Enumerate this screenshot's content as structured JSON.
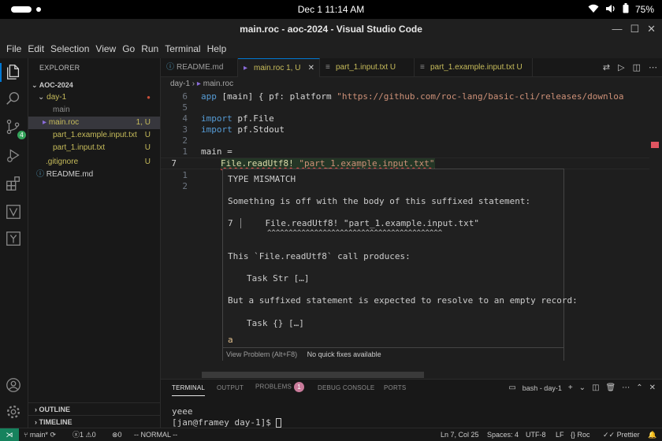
{
  "android": {
    "time": "Dec 1  11:14 AM",
    "battery": "75%"
  },
  "window": {
    "title": "main.roc - aoc-2024 - Visual Studio Code"
  },
  "menu": [
    "File",
    "Edit",
    "Selection",
    "View",
    "Go",
    "Run",
    "Terminal",
    "Help"
  ],
  "explorer": {
    "title": "EXPLORER",
    "root": "AOC-2024",
    "items": [
      {
        "label": "day-1",
        "status": "●"
      },
      {
        "label": "main",
        "status": ""
      },
      {
        "label": "main.roc",
        "status": "1, U"
      },
      {
        "label": "part_1.example.input.txt",
        "status": "U"
      },
      {
        "label": "part_1.input.txt",
        "status": "U"
      },
      {
        "label": ".gitignore",
        "status": "U"
      },
      {
        "label": "README.md",
        "status": ""
      }
    ],
    "outline": "OUTLINE",
    "timeline": "TIMELINE"
  },
  "tabs": [
    {
      "label": "README.md"
    },
    {
      "label": "main.roc  1, U"
    },
    {
      "label": "part_1.input.txt  U"
    },
    {
      "label": "part_1.example.input.txt  U"
    }
  ],
  "breadcrumb": {
    "folder": "day-1",
    "sep": "›",
    "file": "main.roc"
  },
  "editor": {
    "line_numbers": [
      "6",
      "5",
      "4",
      "3",
      "2",
      "1",
      "7",
      "1",
      "2"
    ],
    "lines": {
      "l1_kw": "app",
      "l1_rest": " [main] { pf: platform ",
      "l1_str": "\"https://github.com/roc-lang/basic-cli/releases/downloa",
      "l3_kw": "import",
      "l3_rest": " pf.File",
      "l4_kw": "import",
      "l4_rest": " pf.Stdout",
      "l6": "main =",
      "l7_fn": "File.readUtf8!",
      "l7_str": " \"part_1.example.input.txt\""
    }
  },
  "hover": {
    "title": "TYPE MISMATCH",
    "l1": "Something is off with the body of this suffixed statement:",
    "l2_num": "7",
    "l2_code": "    File.readUtf8! \"part_1.example.input.txt\"",
    "l3": "^^^^^^^^^^^^^^^^^^^^^^^^^^^^^^^^^^^^^^^^^",
    "l4": "This `File.readUtf8` call produces:",
    "l5": "Task Str […]",
    "l6": "But a suffixed statement is expected to resolve to an empty record:",
    "l7": "Task {} […]",
    "l8": "a",
    "view_problem": "View Problem (Alt+F8)",
    "no_fixes": "No quick fixes available"
  },
  "panel": {
    "tabs": [
      "TERMINAL",
      "OUTPUT",
      "PROBLEMS",
      "DEBUG CONSOLE",
      "PORTS"
    ],
    "problems_count": "1",
    "shell": "bash - day-1",
    "terminal_lines": [
      "yeee",
      "[jan@framey day-1]$ "
    ]
  },
  "status": {
    "branch": "main*",
    "errors": "1",
    "warnings": "0",
    "info": "0",
    "mode": "-- NORMAL --",
    "position": "Ln 7, Col 25",
    "spaces": "Spaces: 4",
    "encoding": "UTF-8",
    "eol": "LF",
    "language": "Roc",
    "formatter": "Prettier"
  }
}
